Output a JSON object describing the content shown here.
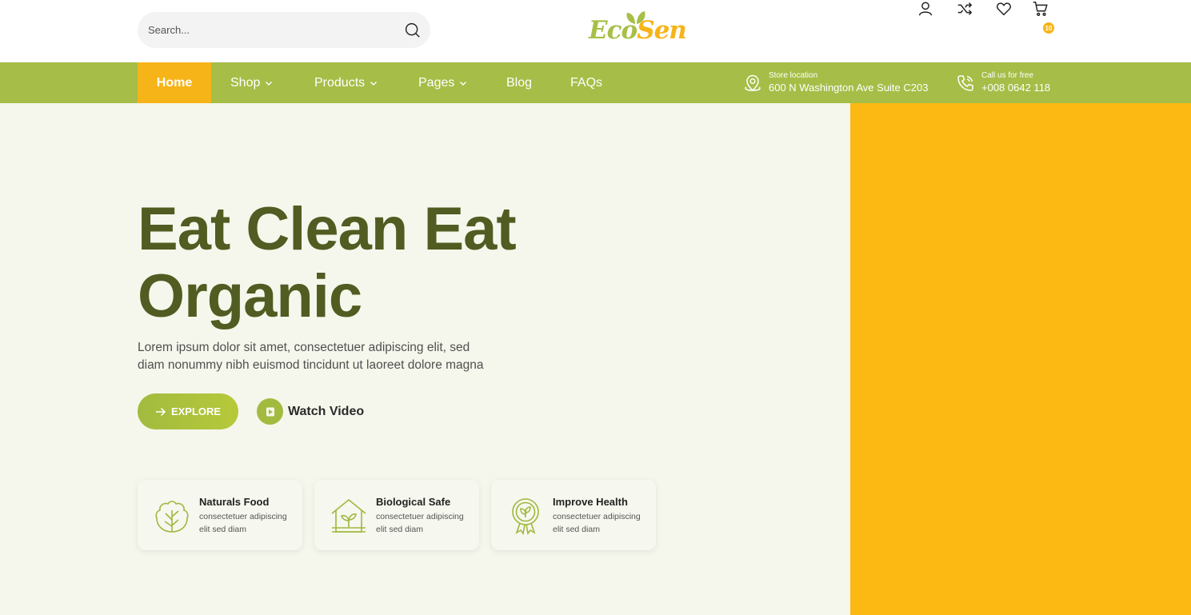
{
  "header": {
    "search_placeholder": "Search...",
    "logo": {
      "part1": "Eco",
      "part2": "Sen"
    },
    "cart_count": "10"
  },
  "nav": {
    "items": [
      {
        "label": "Home",
        "active": true,
        "dropdown": false
      },
      {
        "label": "Shop",
        "active": false,
        "dropdown": true
      },
      {
        "label": "Products",
        "active": false,
        "dropdown": true
      },
      {
        "label": "Pages",
        "active": false,
        "dropdown": true
      },
      {
        "label": "Blog",
        "active": false,
        "dropdown": false
      },
      {
        "label": "FAQs",
        "active": false,
        "dropdown": false
      }
    ],
    "store": {
      "label": "Store location",
      "value": "600 N Washington Ave Suite C203"
    },
    "call": {
      "label": "Call us for free",
      "value": "+008 0642 118"
    }
  },
  "hero": {
    "headline_line1": "Eat Clean Eat",
    "headline_line2": "Organic",
    "description_line1": "Lorem ipsum dolor sit amet, consectetuer adipiscing elit, sed",
    "description_line2": "diam nonummy nibh euismod tincidunt ut laoreet dolore magna",
    "explore_label": "EXPLORE",
    "watch_label": "Watch Video"
  },
  "features": [
    {
      "title": "Naturals Food",
      "desc_line1": "consectetuer adipiscing",
      "desc_line2": "elit sed diam",
      "icon": "lettuce-icon"
    },
    {
      "title": "Biological Safe",
      "desc_line1": "consectetuer adipiscing",
      "desc_line2": "elit sed diam",
      "icon": "greenhouse-icon"
    },
    {
      "title": "Improve Health",
      "desc_line1": "consectetuer adipiscing",
      "desc_line2": "elit sed diam",
      "icon": "leaf-badge-icon"
    }
  ],
  "colors": {
    "brand_green": "#a6bd47",
    "brand_yellow": "#f7b418",
    "headline": "#505c21",
    "hero_bg": "#f5f7ec",
    "hero_right": "#fcb913"
  }
}
